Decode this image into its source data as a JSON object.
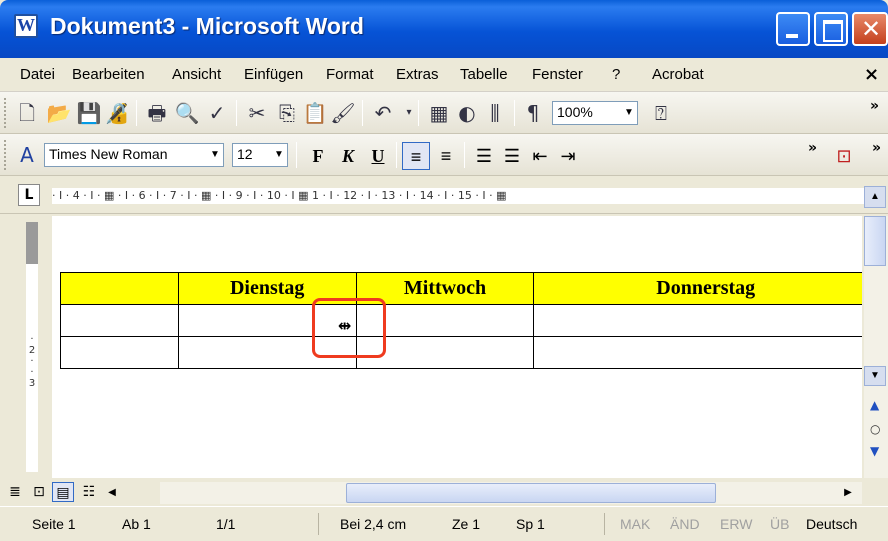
{
  "window": {
    "title": "Dokument3 - Microsoft Word"
  },
  "menu": {
    "items": [
      "Datei",
      "Bearbeiten",
      "Ansicht",
      "Einfügen",
      "Format",
      "Extras",
      "Tabelle",
      "Fenster",
      "?",
      "Acrobat"
    ],
    "close": "×"
  },
  "toolbar": {
    "zoom": "100%"
  },
  "formatting": {
    "font": "Times New Roman",
    "size": "12",
    "bold": "F",
    "italic": "K",
    "underline": "U"
  },
  "ruler": {
    "text": "· I · 4 · I ·  ▦  · I · 6 · I · 7 · I · ▦ · I · 9 · I · 10 · I ▦ 1 · I · 12 · I · 13 · I · 14 · I · 15 · I · ▦"
  },
  "table": {
    "headers": [
      "",
      "Dienstag",
      "Mittwoch",
      "Donnerstag"
    ]
  },
  "status": {
    "page": "Seite 1",
    "section": "Ab 1",
    "pages": "1/1",
    "position": "Bei 2,4 cm",
    "line": "Ze 1",
    "column": "Sp 1",
    "mak": "MAK",
    "aend": "ÄND",
    "erw": "ERW",
    "ueb": "ÜB",
    "language": "Deutsch"
  },
  "icons": [
    "new-icon",
    "open-icon",
    "save-icon",
    "permission-icon",
    "print-icon",
    "print-preview-icon",
    "spelling-icon",
    "cut-icon",
    "copy-icon",
    "paste-icon",
    "format-painter-icon",
    "undo-icon",
    "table-icon",
    "drawing-icon",
    "columns-icon",
    "pilcrow-icon",
    "help-icon"
  ]
}
